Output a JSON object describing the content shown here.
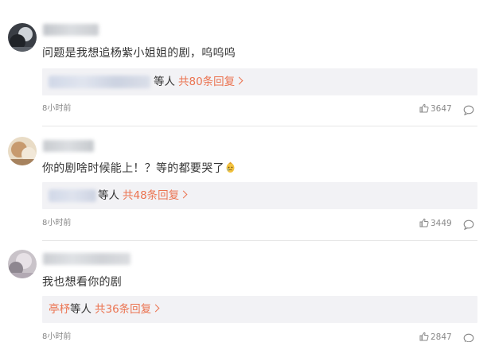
{
  "comments": [
    {
      "username_hidden": true,
      "text": "问题是我想追杨紫小姐姐的剧，呜呜呜",
      "reply": {
        "names_visible": "",
        "suffix": "等人",
        "count_text": "共80条回复"
      },
      "time": "8小时前",
      "likes": "3647"
    },
    {
      "username_hidden": true,
      "text": "你的剧啥时候能上！？等的都要哭了",
      "emoji": "crying-face-emoji",
      "reply": {
        "names_visible": "",
        "suffix": "等人",
        "count_text": "共48条回复"
      },
      "time": "8小时前",
      "likes": "3449"
    },
    {
      "username_hidden": true,
      "text": "我也想看你的剧",
      "reply": {
        "names_visible": "亭杼",
        "suffix": "等人",
        "count_text": "共36条回复"
      },
      "time": "8小时前",
      "likes": "2847"
    }
  ],
  "colors": {
    "link": "#eb7350",
    "reply_bg": "#f2f2f5",
    "meta": "#888888"
  },
  "icons": {
    "like": "thumbs-up-icon",
    "reply": "comment-bubble-icon"
  }
}
